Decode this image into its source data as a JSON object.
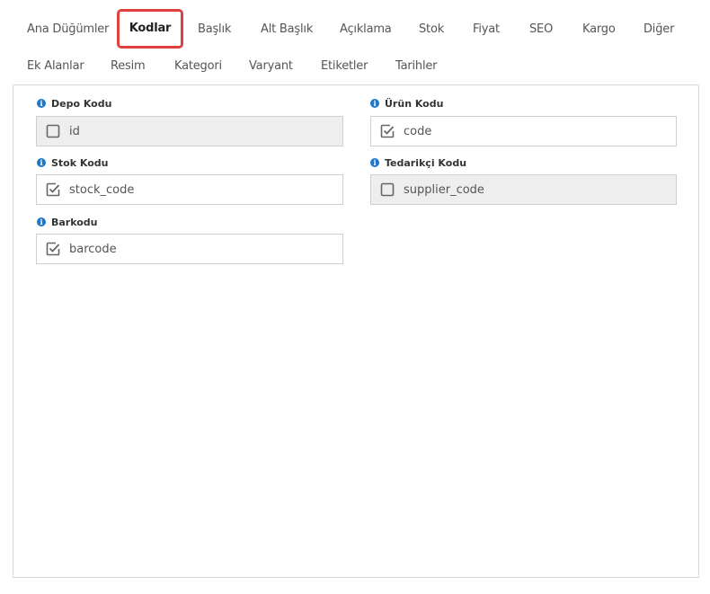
{
  "tabs_row1": [
    {
      "label": "Ana Düğümler",
      "active": false
    },
    {
      "label": "Kodlar",
      "active": true
    },
    {
      "label": "Başlık",
      "active": false
    },
    {
      "label": "Alt Başlık",
      "active": false
    },
    {
      "label": "Açıklama",
      "active": false
    },
    {
      "label": "Stok",
      "active": false
    },
    {
      "label": "Fiyat",
      "active": false
    },
    {
      "label": "SEO",
      "active": false
    },
    {
      "label": "Kargo",
      "active": false
    },
    {
      "label": "Diğer",
      "active": false
    }
  ],
  "tabs_row2": [
    {
      "label": "Ek Alanlar"
    },
    {
      "label": "Resim"
    },
    {
      "label": "Kategori"
    },
    {
      "label": "Varyant"
    },
    {
      "label": "Etiketler"
    },
    {
      "label": "Tarihler"
    }
  ],
  "fields": {
    "depo_kodu": {
      "label": "Depo Kodu",
      "value": "id",
      "checked": false,
      "disabled": true
    },
    "urun_kodu": {
      "label": "Ürün Kodu",
      "value": "code",
      "checked": true,
      "disabled": false
    },
    "stok_kodu": {
      "label": "Stok Kodu",
      "value": "stock_code",
      "checked": true,
      "disabled": false
    },
    "tedarikci_kodu": {
      "label": "Tedarikçi Kodu",
      "value": "supplier_code",
      "checked": false,
      "disabled": true
    },
    "barkodu": {
      "label": "Barkodu",
      "value": "barcode",
      "checked": true,
      "disabled": false
    }
  },
  "icons": {
    "info": "info-icon",
    "checkbox_checked": "checkbox-checked-icon",
    "checkbox_empty": "checkbox-empty-icon"
  },
  "colors": {
    "active_tab_border": "#e0413e",
    "info_icon": "#1f77c7",
    "disabled_field_bg": "#eeeeee"
  }
}
